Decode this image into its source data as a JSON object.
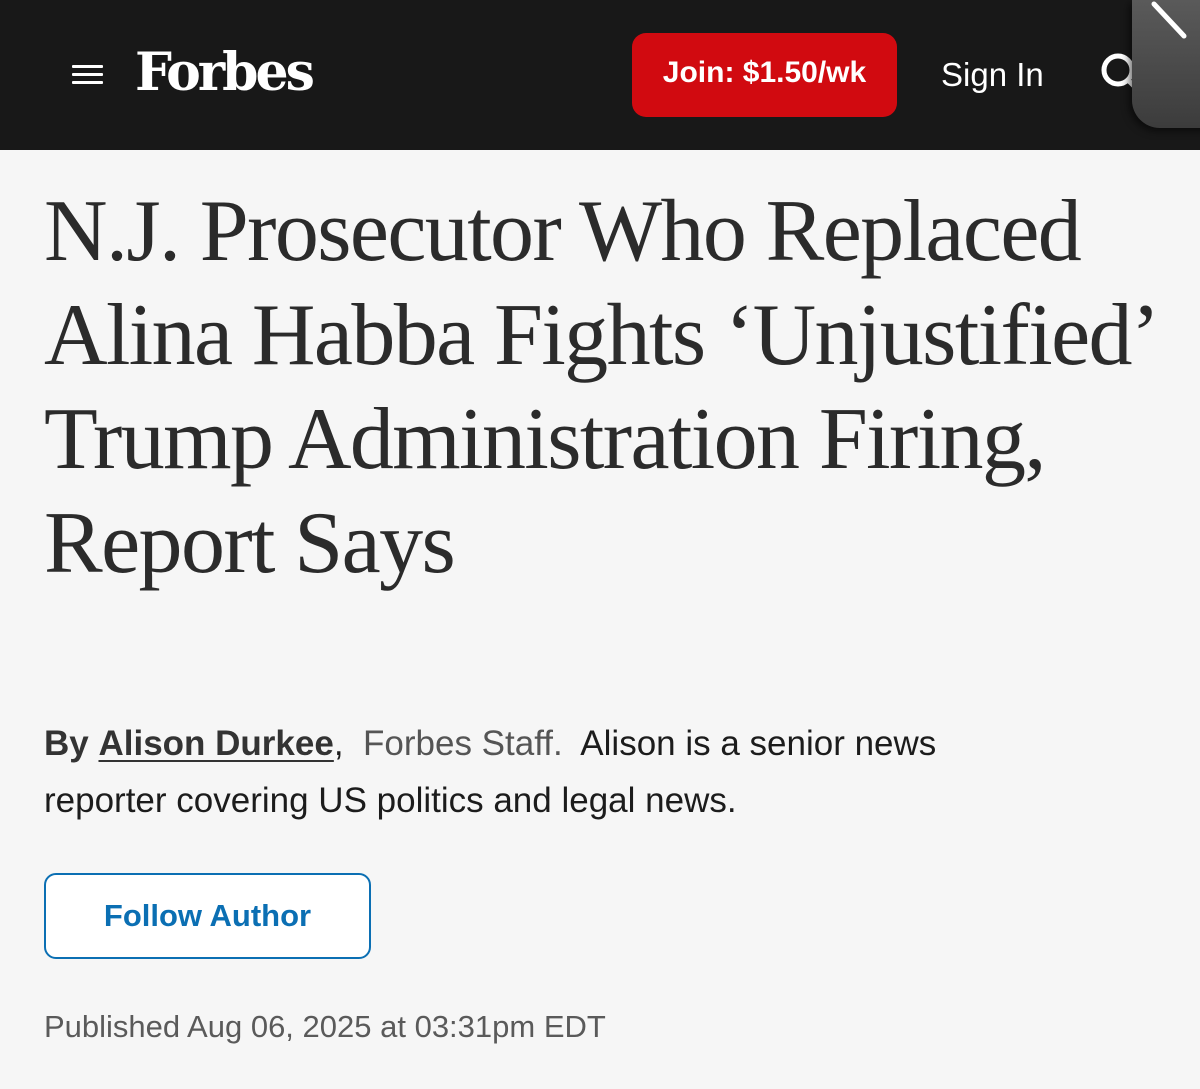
{
  "header": {
    "logo_text": "Forbes",
    "join_label": "Join: $1.50/wk",
    "signin_label": "Sign In",
    "icons": [
      "menu-icon",
      "search-icon"
    ]
  },
  "article": {
    "headline": "N.J. Prosecutor Who Replaced Alina Habba Fights ‘Unjustified’ Trump Administration Firing, Report Says",
    "byline": {
      "by": "By",
      "author_name": "Alison Durkee",
      "comma": ",",
      "role": "Forbes Staff.",
      "bio": "Alison is a senior news reporter covering US politics and legal news."
    },
    "follow_label": "Follow Author",
    "published": "Published Aug 06, 2025 at 03:31pm EDT"
  },
  "colors": {
    "topbar": "#181818",
    "join_button": "#d10a10",
    "follow_button": "#0b6fb3",
    "page_background": "#f6f6f6"
  }
}
